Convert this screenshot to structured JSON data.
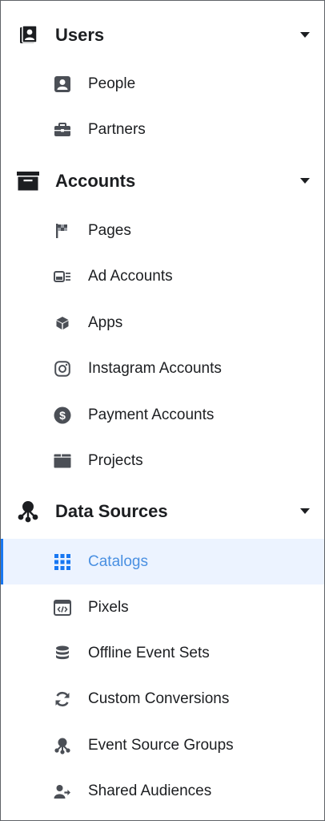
{
  "sections": [
    {
      "title": "Users",
      "icon": "users-badge-icon",
      "items": [
        {
          "label": "People",
          "icon": "person-icon"
        },
        {
          "label": "Partners",
          "icon": "briefcase-icon"
        }
      ]
    },
    {
      "title": "Accounts",
      "icon": "archive-box-icon",
      "items": [
        {
          "label": "Pages",
          "icon": "flag-icon"
        },
        {
          "label": "Ad Accounts",
          "icon": "ad-account-icon"
        },
        {
          "label": "Apps",
          "icon": "cube-icon"
        },
        {
          "label": "Instagram Accounts",
          "icon": "instagram-icon"
        },
        {
          "label": "Payment Accounts",
          "icon": "dollar-circle-icon"
        },
        {
          "label": "Projects",
          "icon": "folder-icon"
        }
      ]
    },
    {
      "title": "Data Sources",
      "icon": "data-sources-icon",
      "items": [
        {
          "label": "Catalogs",
          "icon": "grid-icon",
          "selected": true
        },
        {
          "label": "Pixels",
          "icon": "code-window-icon"
        },
        {
          "label": "Offline Event Sets",
          "icon": "database-stack-icon"
        },
        {
          "label": "Custom Conversions",
          "icon": "refresh-icon"
        },
        {
          "label": "Event Source Groups",
          "icon": "event-source-icon"
        },
        {
          "label": "Shared Audiences",
          "icon": "shared-audience-icon"
        }
      ]
    }
  ],
  "colors": {
    "text": "#1c1e21",
    "icon": "#4b4f56",
    "selected_bg": "#ecf3ff",
    "selected_text": "#4a90e2",
    "selected_bar": "#1877f2"
  }
}
